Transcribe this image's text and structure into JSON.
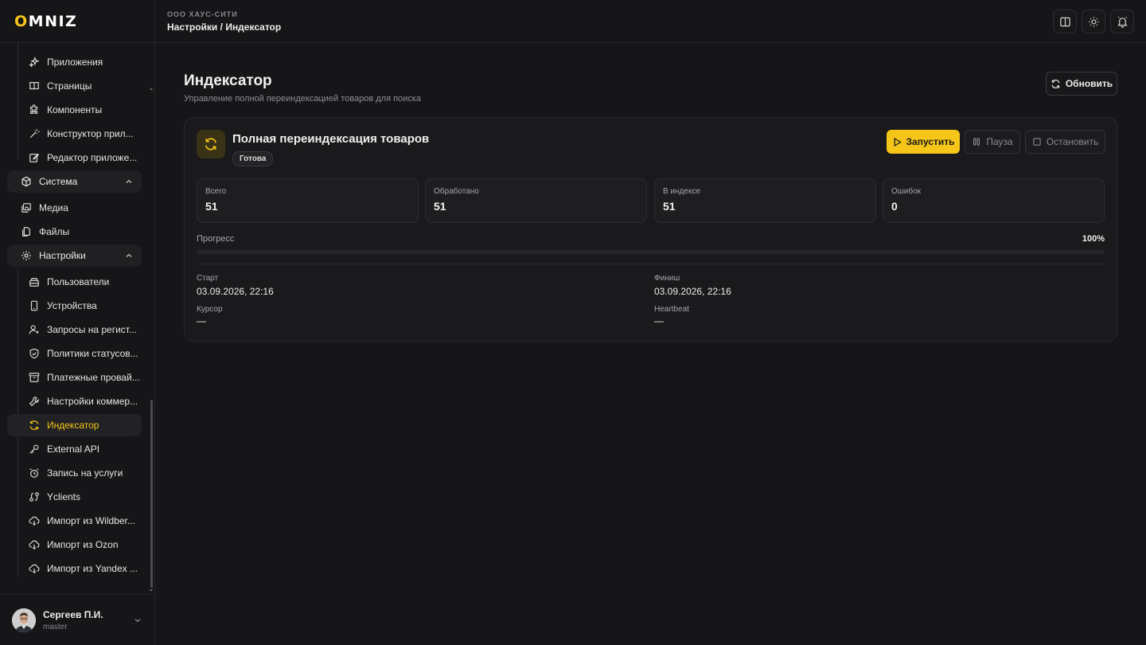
{
  "brand": {
    "logo": "OMNIZ",
    "accent": "#f5c518"
  },
  "sidebar": {
    "items_top": [
      {
        "label": "Приложения",
        "icon": "sparkles-icon"
      },
      {
        "label": "Страницы",
        "icon": "book-icon"
      },
      {
        "label": "Компоненты",
        "icon": "puzzle-icon"
      },
      {
        "label": "Конструктор прил...",
        "icon": "wand-icon"
      },
      {
        "label": "Редактор приложе...",
        "icon": "edit-icon"
      }
    ],
    "section_system": {
      "label": "Система",
      "icon": "box-icon"
    },
    "system_items": [
      {
        "label": "Медиа",
        "icon": "images-icon"
      },
      {
        "label": "Файлы",
        "icon": "files-icon"
      }
    ],
    "section_settings": {
      "label": "Настройки",
      "icon": "gear-icon"
    },
    "settings_items": [
      {
        "label": "Пользователи",
        "icon": "users-card-icon"
      },
      {
        "label": "Устройства",
        "icon": "device-icon"
      },
      {
        "label": "Запросы на регист...",
        "icon": "user-plus-icon"
      },
      {
        "label": "Политики статусов...",
        "icon": "shield-icon"
      },
      {
        "label": "Платежные провай...",
        "icon": "archive-icon"
      },
      {
        "label": "Настройки коммер...",
        "icon": "wrench-icon"
      },
      {
        "label": "Индексатор",
        "icon": "refresh-icon"
      },
      {
        "label": "External API",
        "icon": "key-icon"
      },
      {
        "label": "Запись на услуги",
        "icon": "alarm-icon"
      },
      {
        "label": "Yclients",
        "icon": "route-icon"
      },
      {
        "label": "Импорт из Wildber...",
        "icon": "cloud-download-icon"
      },
      {
        "label": "Импорт из Ozon",
        "icon": "cloud-download-icon"
      },
      {
        "label": "Импорт из Yandex ...",
        "icon": "cloud-download-icon"
      }
    ],
    "user": {
      "name": "Сергеев П.И.",
      "role": "master"
    }
  },
  "topbar": {
    "org": "ООО ХАУС-СИТИ",
    "breadcrumb": "Настройки / Индексатор"
  },
  "page": {
    "title": "Индексатор",
    "subtitle": "Управление полной переиндексацией товаров для поиска",
    "refresh_label": "Обновить"
  },
  "job": {
    "title": "Полная переиндексация товаров",
    "status": "Готова",
    "start_label": "Запустить",
    "pause_label": "Пауза",
    "stop_label": "Остановить",
    "stats": [
      {
        "label": "Всего",
        "value": "51"
      },
      {
        "label": "Обработано",
        "value": "51"
      },
      {
        "label": "В индексе",
        "value": "51"
      },
      {
        "label": "Ошибок",
        "value": "0"
      }
    ],
    "progress_label": "Прогресс",
    "progress_pct": "100%",
    "progress_fraction": 1.0,
    "meta": {
      "start_label": "Старт",
      "start_value": "03.09.2026, 22:16",
      "finish_label": "Финиш",
      "finish_value": "03.09.2026, 22:16",
      "cursor_label": "Курсор",
      "cursor_value": "—",
      "heartbeat_label": "Heartbeat",
      "heartbeat_value": "—"
    }
  }
}
